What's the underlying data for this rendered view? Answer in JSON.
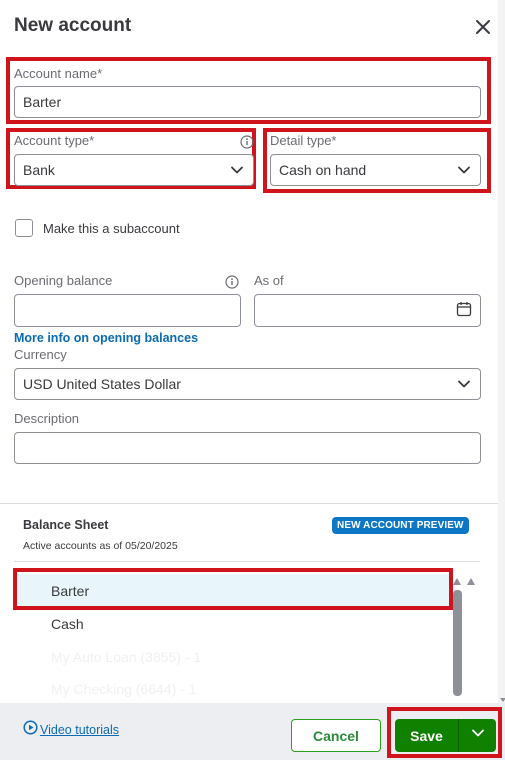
{
  "dialog": {
    "title": "New account"
  },
  "account_name": {
    "label": "Account name*",
    "value": "Barter"
  },
  "account_type": {
    "label": "Account type*",
    "value": "Bank"
  },
  "detail_type": {
    "label": "Detail type*",
    "value": "Cash on hand"
  },
  "subaccount": {
    "label": "Make this a subaccount",
    "checked": false
  },
  "opening_balance": {
    "label": "Opening balance",
    "value": ""
  },
  "as_of": {
    "label": "As of",
    "value": ""
  },
  "more_info_link": "More info on opening balances",
  "currency": {
    "label": "Currency",
    "value": "USD United States Dollar"
  },
  "description": {
    "label": "Description",
    "value": ""
  },
  "preview": {
    "title": "Balance Sheet",
    "subtitle": "Active accounts as of 05/20/2025",
    "badge": "NEW ACCOUNT PREVIEW",
    "rows": [
      "Barter",
      "Cash",
      "My Auto Loan (3855) - 1",
      "My Checking (6644) - 1"
    ]
  },
  "footer": {
    "video_link": "Video tutorials",
    "cancel_label": "Cancel",
    "save_label": "Save"
  },
  "colors": {
    "highlight": "#d0141b",
    "primary_green": "#108000",
    "badge_blue": "#0b77c5",
    "link_blue": "#0b6bb3"
  }
}
